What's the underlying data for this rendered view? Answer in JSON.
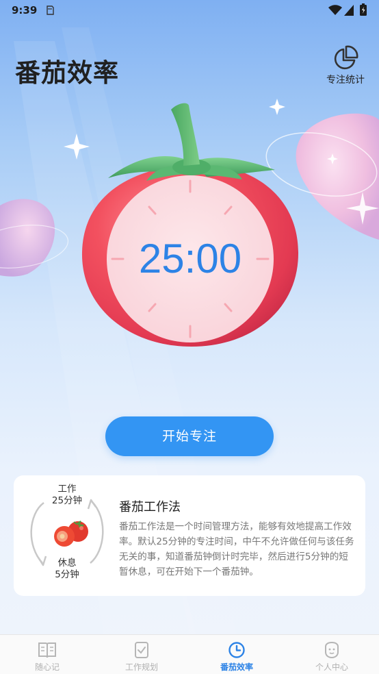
{
  "status_bar": {
    "time": "9:39"
  },
  "header": {
    "title": "番茄效率",
    "stats_label": "专注统计",
    "stats_icon": "pie-chart-icon"
  },
  "timer": {
    "display": "25:00"
  },
  "start_button": {
    "label": "开始专注"
  },
  "info_card": {
    "cycle": {
      "work_label": "工作",
      "work_duration": "25分钟",
      "rest_label": "休息",
      "rest_duration": "5分钟"
    },
    "title": "番茄工作法",
    "description": "番茄工作法是一个时间管理方法，能够有效地提高工作效率。默认25分钟的专注时间，中午不允许做任何与该任务无关的事，知道番茄钟倒计时完毕，然后进行5分钟的短暂休息，可在开始下一个番茄钟。"
  },
  "bottom_nav": {
    "items": [
      {
        "label": "随心记",
        "icon": "book-icon",
        "active": false
      },
      {
        "label": "工作规划",
        "icon": "checklist-icon",
        "active": false
      },
      {
        "label": "番茄效率",
        "icon": "clock-icon",
        "active": true
      },
      {
        "label": "个人中心",
        "icon": "face-icon",
        "active": false
      }
    ]
  },
  "colors": {
    "accent": "#3395f3",
    "timer_text": "#2d83e6",
    "tomato": "#f0485c",
    "leaf": "#4caf6a",
    "inactive_nav": "#b0b0b0"
  }
}
